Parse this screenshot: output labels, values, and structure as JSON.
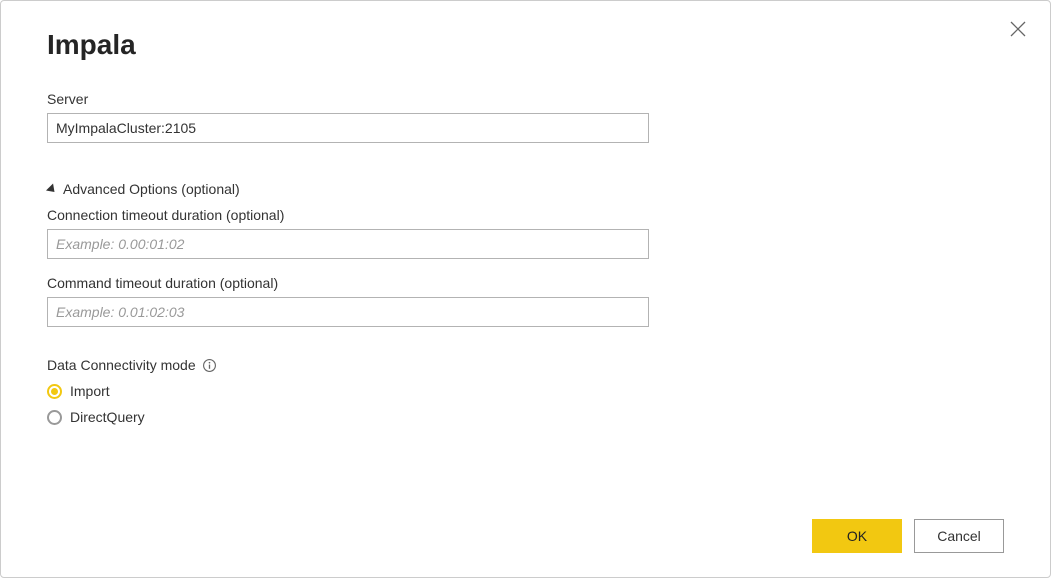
{
  "dialog": {
    "title": "Impala"
  },
  "server": {
    "label": "Server",
    "value": "MyImpalaCluster:2105"
  },
  "advanced": {
    "header": "Advanced Options (optional)",
    "conn_timeout": {
      "label": "Connection timeout duration (optional)",
      "placeholder": "Example: 0.00:01:02",
      "value": ""
    },
    "cmd_timeout": {
      "label": "Command timeout duration (optional)",
      "placeholder": "Example: 0.01:02:03",
      "value": ""
    }
  },
  "connectivity": {
    "label": "Data Connectivity mode",
    "options": {
      "import": "Import",
      "directquery": "DirectQuery"
    },
    "selected": "import"
  },
  "buttons": {
    "ok": "OK",
    "cancel": "Cancel"
  }
}
